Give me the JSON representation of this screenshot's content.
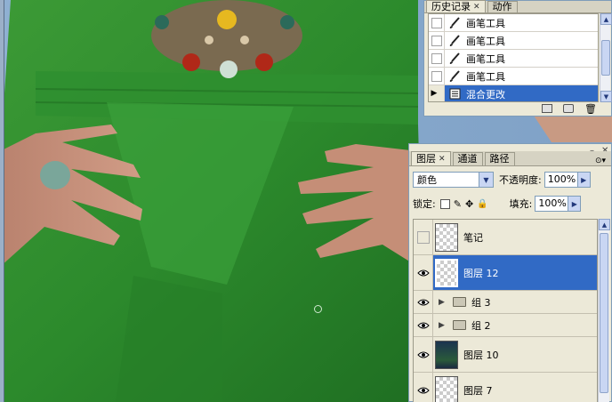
{
  "history": {
    "tabs": [
      {
        "label": "历史记录",
        "active": true
      },
      {
        "label": "动作",
        "active": false
      }
    ],
    "steps": [
      {
        "label": "画笔工具",
        "icon": "brush-icon",
        "selected": false
      },
      {
        "label": "画笔工具",
        "icon": "brush-icon",
        "selected": false
      },
      {
        "label": "画笔工具",
        "icon": "brush-icon",
        "selected": false
      },
      {
        "label": "画笔工具",
        "icon": "brush-icon",
        "selected": false
      },
      {
        "label": "混合更改",
        "icon": "blend-change-icon",
        "selected": true
      }
    ],
    "bottom_icons": [
      "new-document-icon",
      "snapshot-icon",
      "trash-icon"
    ]
  },
  "layers": {
    "tabs": [
      {
        "label": "图层",
        "active": true
      },
      {
        "label": "通道",
        "active": false
      },
      {
        "label": "路径",
        "active": false
      }
    ],
    "blend_mode": "颜色",
    "opacity_label": "不透明度:",
    "opacity_value": "100%",
    "lock_label": "锁定:",
    "fill_label": "填充:",
    "fill_value": "100%",
    "items": [
      {
        "name": "笔记",
        "type": "layer",
        "visible": false,
        "thumb": "transparent",
        "selected": false
      },
      {
        "name": "图层 12",
        "type": "layer",
        "visible": true,
        "thumb": "transparent",
        "selected": true
      },
      {
        "name": "组 3",
        "type": "group",
        "visible": true,
        "selected": false
      },
      {
        "name": "组 2",
        "type": "group",
        "visible": true,
        "selected": false
      },
      {
        "name": "图层 10",
        "type": "layer",
        "visible": true,
        "thumb": "photo",
        "selected": false
      },
      {
        "name": "图层 7",
        "type": "layer",
        "visible": true,
        "thumb": "transparent",
        "selected": false
      }
    ]
  },
  "colors": {
    "selection": "#316ac5",
    "panel_bg": "#ece9d8",
    "dress_green": "#2e8a2e",
    "background_blue": "#7fa1c6"
  }
}
